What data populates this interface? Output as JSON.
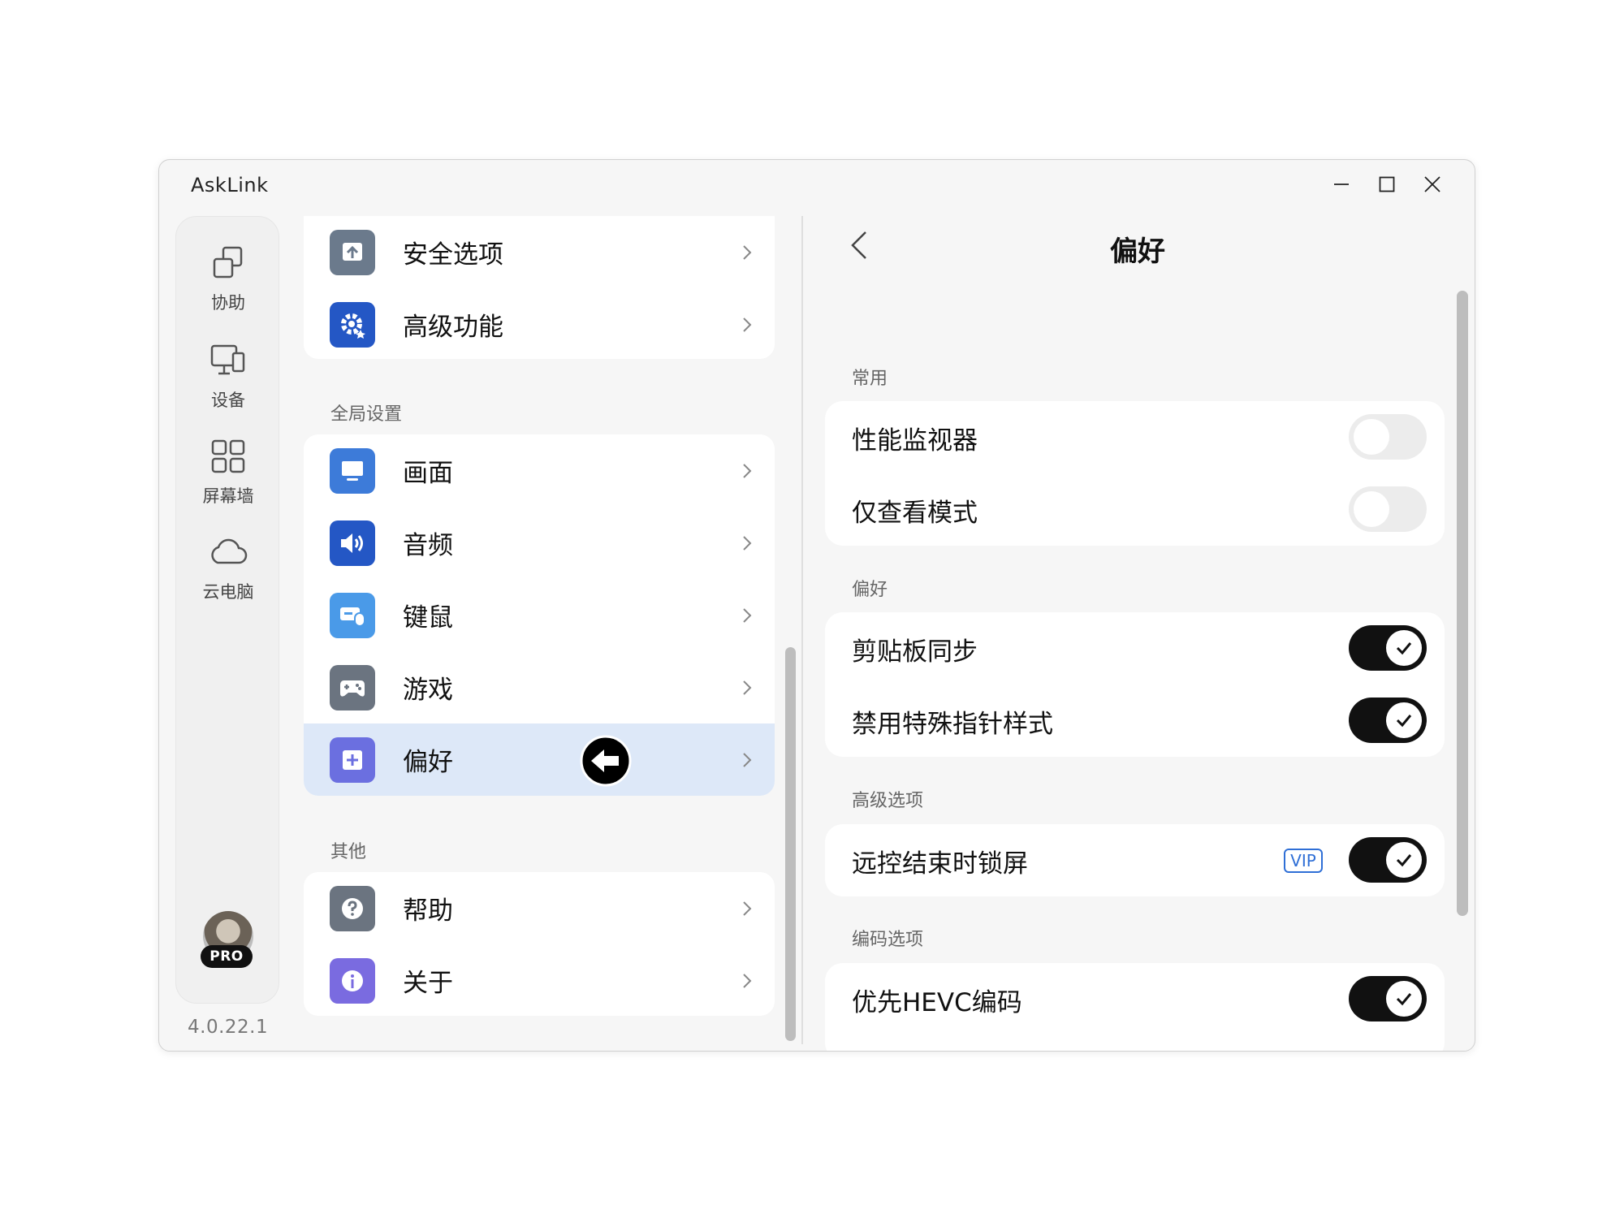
{
  "window": {
    "title": "AskLink"
  },
  "rail": {
    "items": [
      {
        "label": "协助",
        "icon": "collaborate-icon"
      },
      {
        "label": "设备",
        "icon": "devices-icon"
      },
      {
        "label": "屏幕墙",
        "icon": "grid-icon"
      },
      {
        "label": "云电脑",
        "icon": "cloud-icon"
      }
    ],
    "badge": "PRO",
    "version": "4.0.22.1"
  },
  "middle": {
    "group1": [
      {
        "label": "安全选项",
        "icon": "security-icon",
        "color": "#6b7a8c"
      },
      {
        "label": "高级功能",
        "icon": "gear-icon",
        "color": "#2457c5"
      }
    ],
    "section_global": "全局设置",
    "global": [
      {
        "label": "画面",
        "icon": "display-icon",
        "color": "#3d7bd9"
      },
      {
        "label": "音频",
        "icon": "speaker-icon",
        "color": "#2457c5"
      },
      {
        "label": "键鼠",
        "icon": "keyboard-mouse-icon",
        "color": "#4a9ae8"
      },
      {
        "label": "游戏",
        "icon": "gamepad-icon",
        "color": "#6b7480"
      },
      {
        "label": "偏好",
        "icon": "plus-square-icon",
        "color": "#6b6fe0"
      }
    ],
    "section_other": "其他",
    "other": [
      {
        "label": "帮助",
        "icon": "help-icon",
        "color": "#6b7480"
      },
      {
        "label": "关于",
        "icon": "info-icon",
        "color": "#7a6be0"
      }
    ]
  },
  "right": {
    "title": "偏好",
    "sections": [
      {
        "title": "常用",
        "rows": [
          {
            "label": "性能监视器",
            "on": false
          },
          {
            "label": "仅查看模式",
            "on": false
          }
        ]
      },
      {
        "title": "偏好",
        "rows": [
          {
            "label": "剪贴板同步",
            "on": true
          },
          {
            "label": "禁用特殊指针样式",
            "on": true
          }
        ]
      },
      {
        "title": "高级选项",
        "rows": [
          {
            "label": "远控结束时锁屏",
            "on": true,
            "badge": "VIP"
          }
        ]
      },
      {
        "title": "编码选项",
        "rows": [
          {
            "label": "优先HEVC编码",
            "on": true
          }
        ]
      }
    ]
  }
}
